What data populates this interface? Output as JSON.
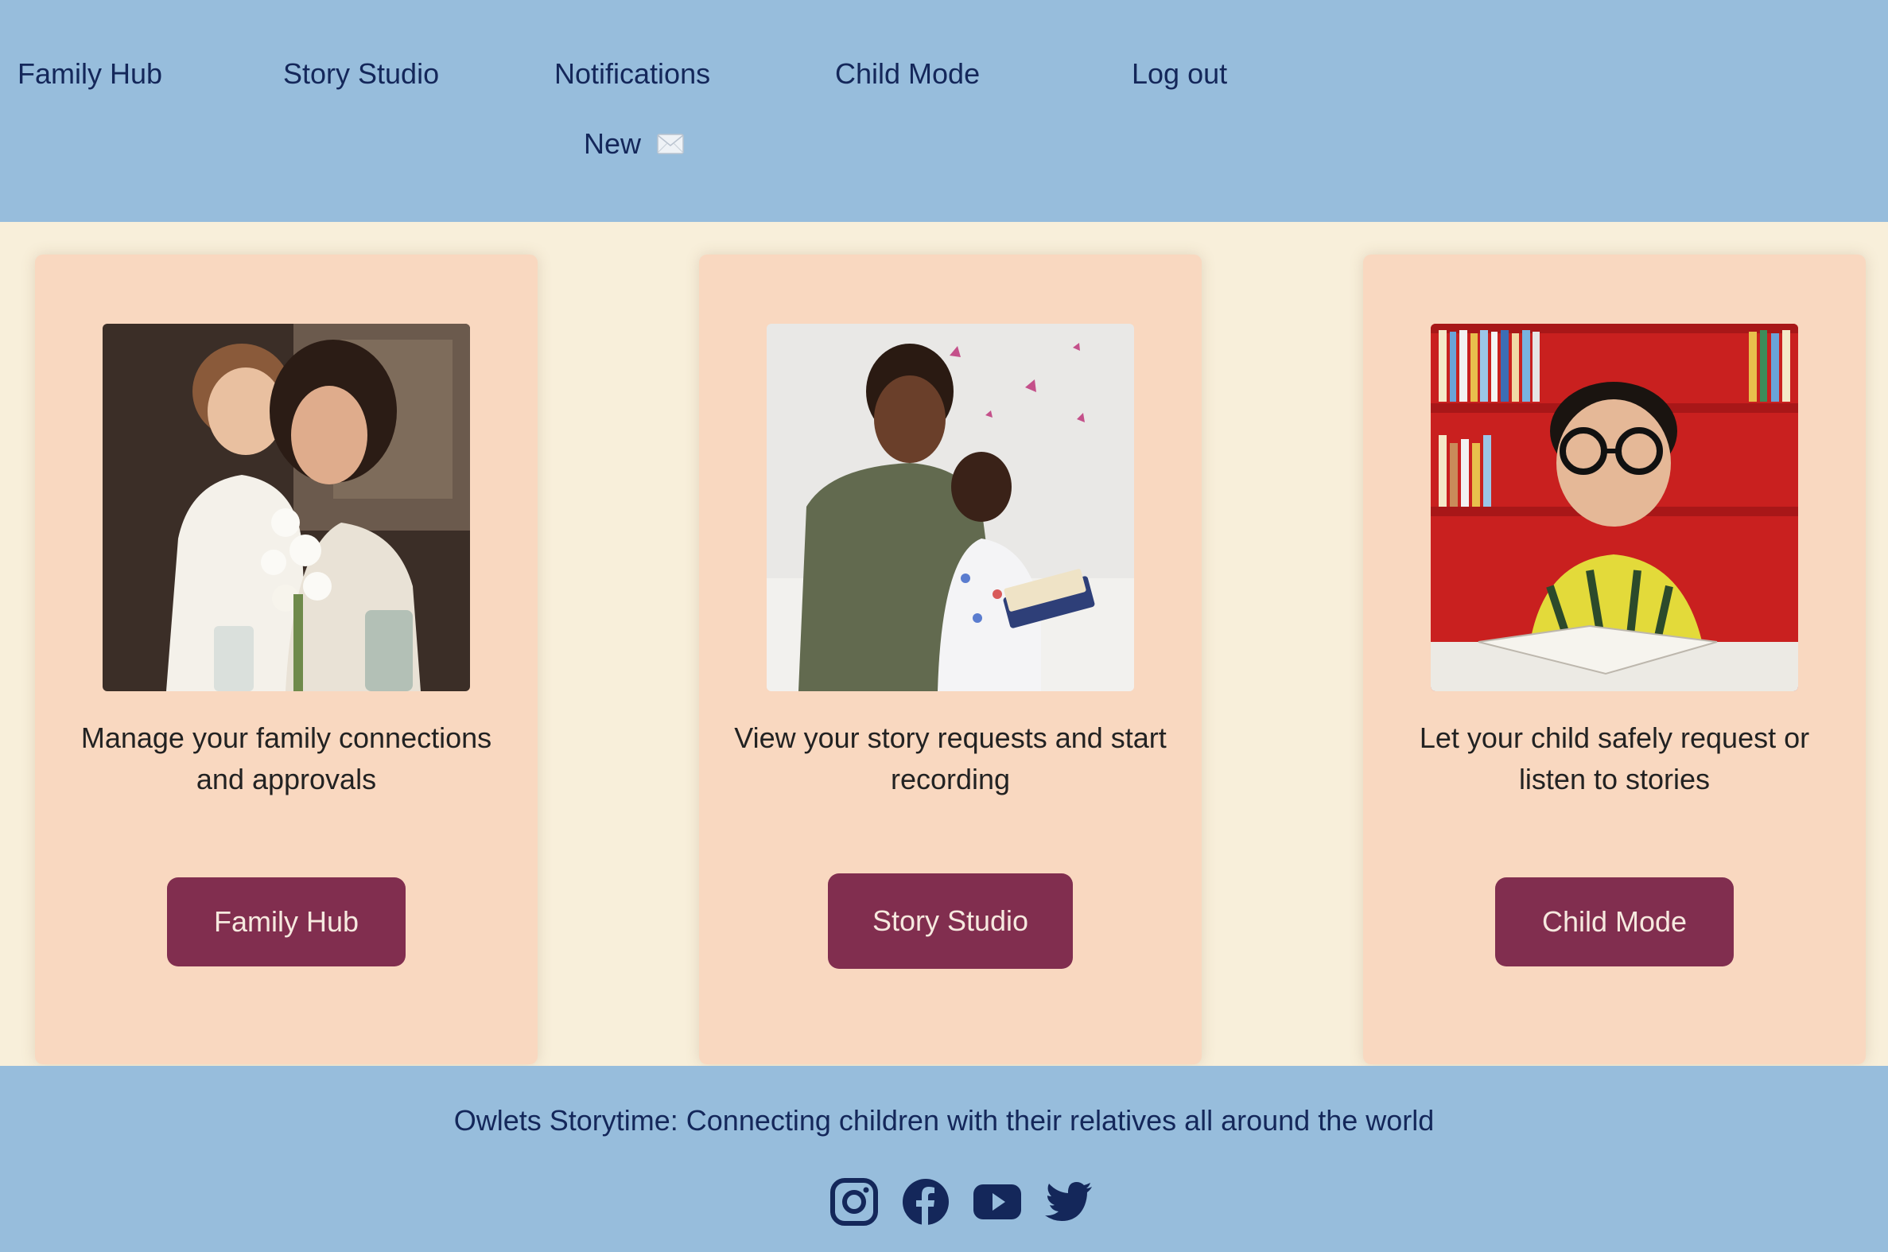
{
  "nav": {
    "items": [
      {
        "label": "Family Hub"
      },
      {
        "label": "Story Studio"
      },
      {
        "label": "Notifications"
      },
      {
        "label": "Child Mode"
      },
      {
        "label": "Log out"
      }
    ],
    "notification_badge": "New",
    "notification_icon": "envelope-icon"
  },
  "cards": [
    {
      "image": "family-photo",
      "description": "Manage your family connections and approvals",
      "button_label": "Family Hub"
    },
    {
      "image": "story-reading-photo",
      "description": "View your story requests and start recording",
      "button_label": "Story Studio"
    },
    {
      "image": "child-photo",
      "description": "Let your child safely request or listen to stories",
      "button_label": "Child Mode"
    }
  ],
  "footer": {
    "tagline": "Owlets Storytime: Connecting children with their relatives all around the world",
    "social_icons": [
      "instagram-icon",
      "facebook-icon",
      "youtube-icon",
      "twitter-icon"
    ]
  },
  "colors": {
    "header_bg": "#97bddc",
    "page_bg": "#f8efda",
    "card_bg": "#f9d8c0",
    "button_bg": "#812e4f",
    "nav_text": "#14275a"
  }
}
